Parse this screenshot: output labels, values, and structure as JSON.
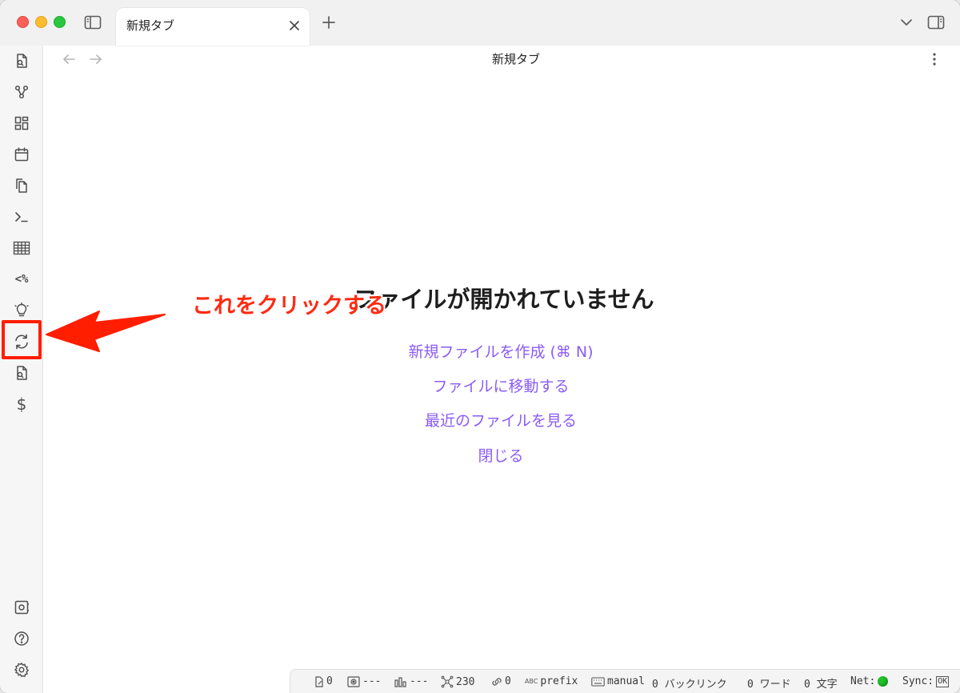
{
  "tab": {
    "title": "新規タブ"
  },
  "view": {
    "title": "新規タブ"
  },
  "ribbon": {
    "icons": [
      "file-search-icon",
      "graph-icon",
      "layout-grid-icon",
      "calendar-icon",
      "copy-icon",
      "terminal-icon",
      "table-icon",
      "templater-icon",
      "lightbulb-icon",
      "sync-icon",
      "file-search-2-icon",
      "dollar-icon"
    ],
    "templater_label": "<%",
    "dollar_label": "$",
    "bottom_icons": [
      "vault-icon",
      "help-icon",
      "settings-icon"
    ]
  },
  "empty_state": {
    "title": "ファイルが開かれていません",
    "actions": [
      "新規ファイルを作成 (⌘ N)",
      "ファイルに移動する",
      "最近のファイルを見る",
      "閉じる"
    ]
  },
  "annotation": {
    "text": "これをクリックする",
    "color": "#ff2a12"
  },
  "status_bar": {
    "edit_count": "0",
    "focus_value": "---",
    "stats_value": "---",
    "graph_count": "230",
    "link_count": "0",
    "abc_label": "ABC",
    "prefix_label": "prefix",
    "manual_label": "manual",
    "backlinks": "0 バックリンク",
    "words": "0 ワード",
    "chars": "0 文字",
    "net_label": "Net:",
    "sync_label": "Sync:",
    "sync_state": "OK"
  },
  "colors": {
    "accent": "#8a5cf5",
    "annotation": "#ff1e00",
    "net_ok": "#1fc12a"
  }
}
